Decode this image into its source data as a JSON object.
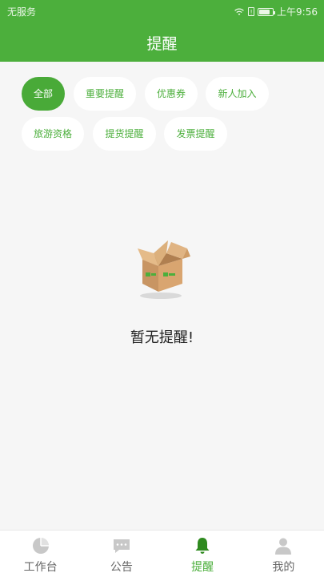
{
  "status_bar": {
    "carrier": "无服务",
    "sim_label": "!",
    "time": "上午9:56",
    "battery_level": 0.8
  },
  "header": {
    "title": "提醒"
  },
  "filters": [
    {
      "label": "全部",
      "active": true
    },
    {
      "label": "重要提醒",
      "active": false
    },
    {
      "label": "优惠券",
      "active": false
    },
    {
      "label": "新人加入",
      "active": false
    },
    {
      "label": "旅游资格",
      "active": false
    },
    {
      "label": "提货提醒",
      "active": false
    },
    {
      "label": "发票提醒",
      "active": false
    }
  ],
  "empty_state": {
    "message": "暂无提醒!",
    "icon": "box-icon"
  },
  "tabbar": [
    {
      "label": "工作台",
      "icon": "pie-chart-icon",
      "active": false
    },
    {
      "label": "公告",
      "icon": "message-icon",
      "active": false
    },
    {
      "label": "提醒",
      "icon": "bell-icon",
      "active": true
    },
    {
      "label": "我的",
      "icon": "person-icon",
      "active": false
    }
  ],
  "colors": {
    "accent": "#4caf3c",
    "active_chip": "#49aa38",
    "background": "#f6f6f6",
    "inactive_tab": "#c8c8c8"
  }
}
